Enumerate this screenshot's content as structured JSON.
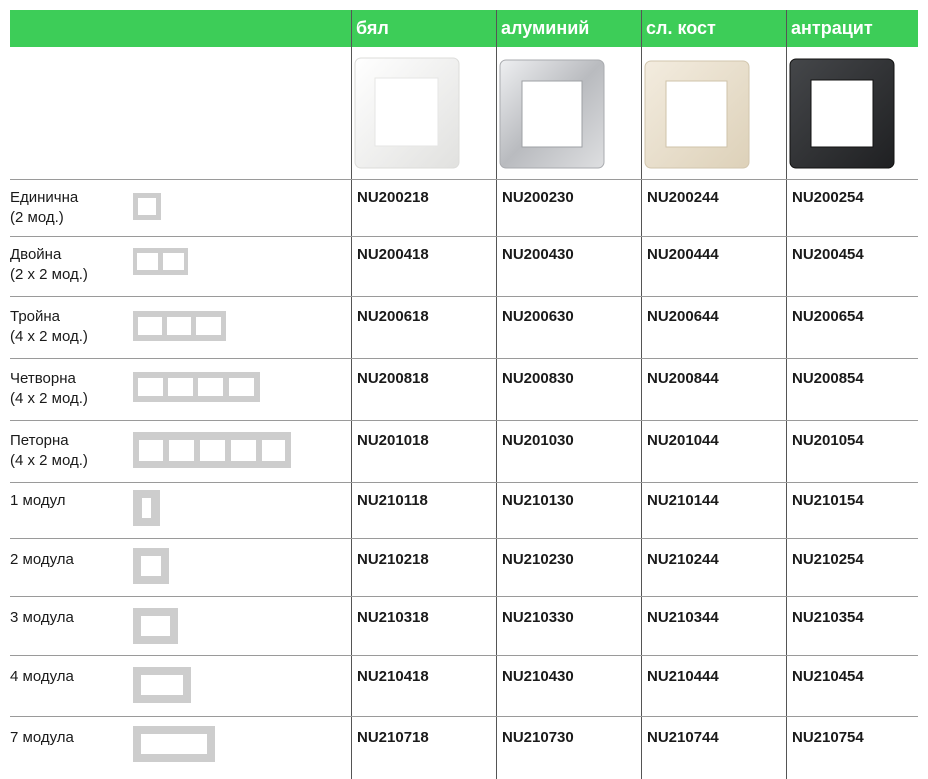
{
  "header": {
    "columns": [
      "бял",
      "алуминий",
      "сл. кост",
      "антрацит"
    ]
  },
  "colors": {
    "header_green": "#3dcd58",
    "white": "#f2f2f0",
    "aluminium": "#c9cacc",
    "ivory": "#e9dfcb",
    "anthracite": "#2e2f31"
  },
  "images": [
    {
      "finish": "бял",
      "icon": "white-frame-image"
    },
    {
      "finish": "алуминий",
      "icon": "aluminium-frame-image"
    },
    {
      "finish": "сл. кост",
      "icon": "ivory-frame-image"
    },
    {
      "finish": "антрацит",
      "icon": "anthracite-frame-image"
    }
  ],
  "rows": [
    {
      "label_1": "Единична",
      "label_2": "(2 мод.)",
      "codes": [
        "NU200218",
        "NU200230",
        "NU200244",
        "NU200254"
      ]
    },
    {
      "label_1": "Двойна",
      "label_2": "(2 x 2 мод.)",
      "codes": [
        "NU200418",
        "NU200430",
        "NU200444",
        "NU200454"
      ]
    },
    {
      "label_1": "Тройна",
      "label_2": "(4 x 2 мод.)",
      "codes": [
        "NU200618",
        "NU200630",
        "NU200644",
        "NU200654"
      ]
    },
    {
      "label_1": "Четворна",
      "label_2": "(4 x 2 мод.)",
      "codes": [
        "NU200818",
        "NU200830",
        "NU200844",
        "NU200854"
      ]
    },
    {
      "label_1": "Петорна",
      "label_2": "(4 x 2 мод.)",
      "codes": [
        "NU201018",
        "NU201030",
        "NU201044",
        "NU201054"
      ]
    },
    {
      "label_1": "1 модул",
      "label_2": "",
      "codes": [
        "NU210118",
        "NU210130",
        "NU210144",
        "NU210154"
      ]
    },
    {
      "label_1": "2 модула",
      "label_2": "",
      "codes": [
        "NU210218",
        "NU210230",
        "NU210244",
        "NU210254"
      ]
    },
    {
      "label_1": "3 модула",
      "label_2": "",
      "codes": [
        "NU210318",
        "NU210330",
        "NU210344",
        "NU210354"
      ]
    },
    {
      "label_1": "4 модула",
      "label_2": "",
      "codes": [
        "NU210418",
        "NU210430",
        "NU210444",
        "NU210454"
      ]
    },
    {
      "label_1": "7 модула",
      "label_2": "",
      "codes": [
        "NU210718",
        "NU210730",
        "NU210744",
        "NU210754"
      ]
    }
  ]
}
